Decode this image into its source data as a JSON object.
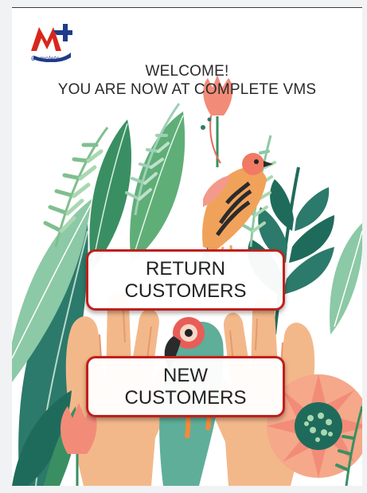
{
  "brand": {
    "logo_text": "Complete"
  },
  "welcome": {
    "line1": "WELCOME!",
    "line2": "YOU ARE NOW AT COMPLETE VMS"
  },
  "actions": {
    "return_line1": "RETURN",
    "return_line2": "CUSTOMERS",
    "new_line1": "NEW",
    "new_line2": "CUSTOMERS"
  },
  "colors": {
    "button_border": "#c0201c",
    "logo_red": "#d9261c",
    "logo_blue": "#1f3b8a"
  }
}
